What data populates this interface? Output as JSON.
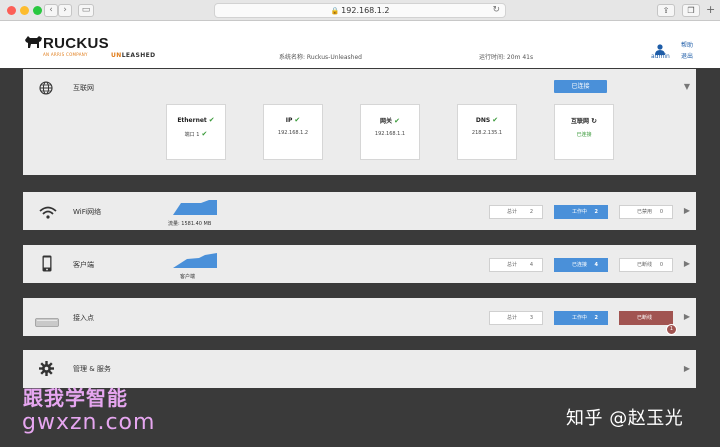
{
  "browser": {
    "url": "192.168.1.2",
    "back_icon": "chevron-left-icon",
    "forward_icon": "chevron-right-icon"
  },
  "header": {
    "brand": "RUCKUS",
    "brand_sub": "AN ARRIS COMPANY",
    "product_prefix": "UN",
    "product_rest": "LEASHED",
    "system_name": "系统名称: Ruckus-Unleashed",
    "uptime": "运行时间: 20m 41s",
    "user": "admin",
    "help": "帮助",
    "logout": "退出"
  },
  "internet": {
    "title": "互联网",
    "status": "已连接",
    "cards": [
      {
        "title": "Ethernet",
        "value": "端口 1"
      },
      {
        "title": "IP",
        "value": "192.168.1.2"
      },
      {
        "title": "网关",
        "value": "192.168.1.1"
      },
      {
        "title": "DNS",
        "value": "218.2.135.1"
      },
      {
        "title": "互联网",
        "value": "已连接"
      }
    ]
  },
  "wifi": {
    "title": "WiFi网络",
    "spark_label": "流量: 1581.40 MB",
    "counters": [
      {
        "label": "总计",
        "value": "2"
      },
      {
        "label": "工作中",
        "value": "2"
      },
      {
        "label": "已禁用",
        "value": "0"
      }
    ]
  },
  "clients": {
    "title": "客户端",
    "spark_label": "客户端",
    "counters": [
      {
        "label": "总计",
        "value": "4"
      },
      {
        "label": "已连接",
        "value": "4"
      },
      {
        "label": "已断线",
        "value": "0"
      }
    ]
  },
  "aps": {
    "title": "接入点",
    "counters": [
      {
        "label": "总计",
        "value": "3"
      },
      {
        "label": "工作中",
        "value": "2"
      },
      {
        "label": "已断线",
        "value": "1"
      }
    ]
  },
  "admin": {
    "title": "管理 & 服务"
  },
  "watermarks": {
    "line1": "跟我学智能",
    "line2": "gwxzn.com",
    "credit": "知乎 @赵玉光"
  },
  "colors": {
    "accent_blue": "#4a90d9",
    "alert_red": "#a15451",
    "ok_green": "#3a9a3a",
    "brand_orange": "#e07b18"
  }
}
